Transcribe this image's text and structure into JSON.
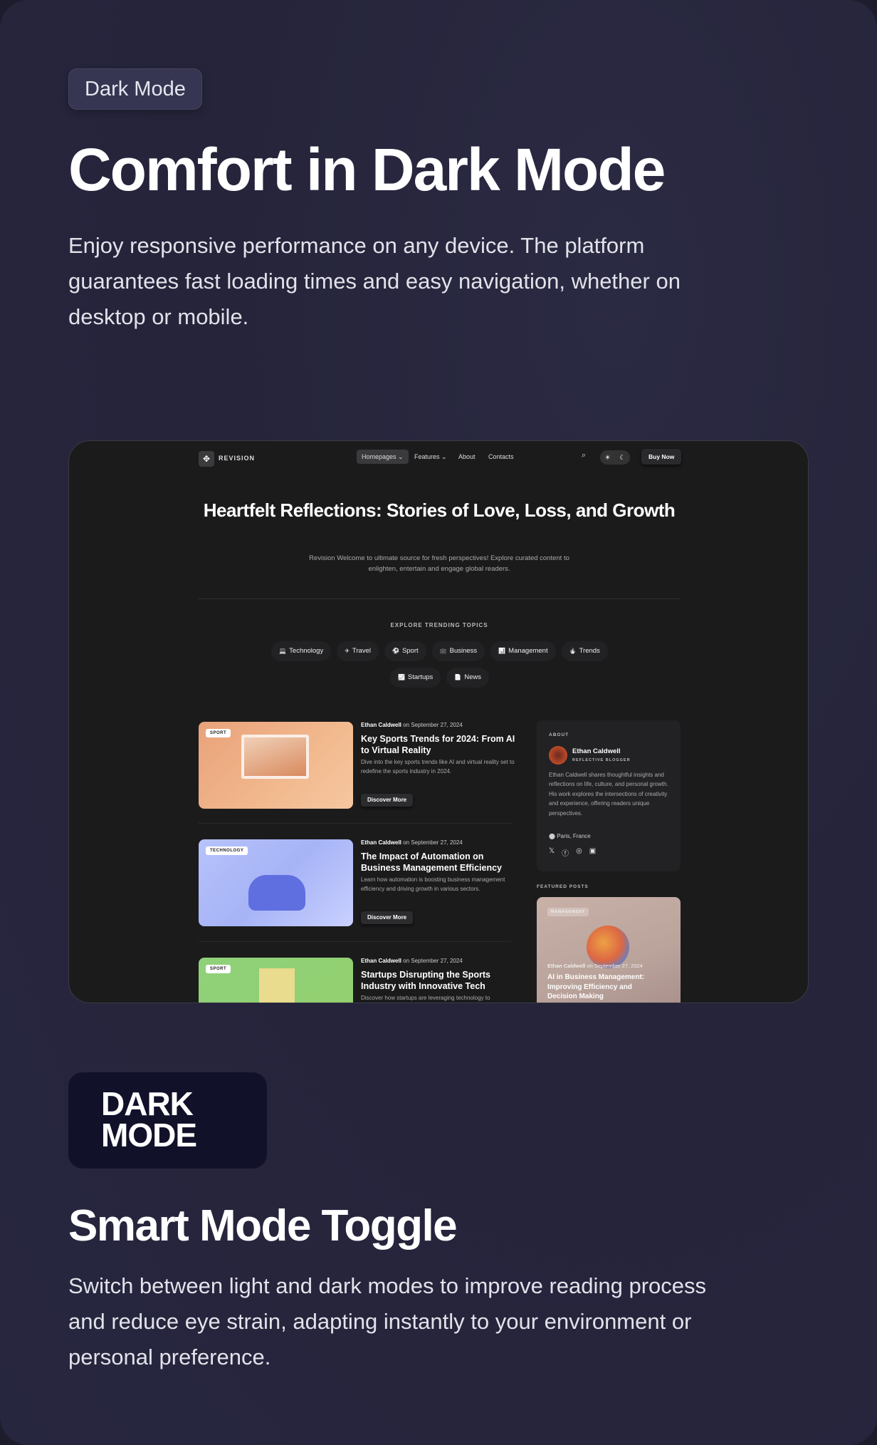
{
  "badge": "Dark Mode",
  "hero": {
    "title": "Comfort in Dark Mode",
    "description": "Enjoy responsive performance on any device. The platform guarantees fast loading times and easy navigation, whether on desktop or mobile."
  },
  "preview": {
    "brand": "REVISION",
    "nav": [
      {
        "label": "Homepages ⌄"
      },
      {
        "label": "Features ⌄"
      },
      {
        "label": "About"
      },
      {
        "label": "Contacts"
      }
    ],
    "buy_label": "Buy Now",
    "title": "Heartfelt Reflections: Stories of Love, Loss, and Growth",
    "subtitle": "Revision Welcome to ultimate source for fresh perspectives! Explore curated content to enlighten, entertain and engage global readers.",
    "explore_label": "EXPLORE TRENDING TOPICS",
    "topics": [
      {
        "icon": "laptop-icon",
        "glyph": "💻",
        "label": "Technology"
      },
      {
        "icon": "plane-icon",
        "glyph": "✈",
        "label": "Travel"
      },
      {
        "icon": "ball-icon",
        "glyph": "⚽",
        "label": "Sport"
      },
      {
        "icon": "briefcase-icon",
        "glyph": "💼",
        "label": "Business"
      },
      {
        "icon": "chart-icon",
        "glyph": "📊",
        "label": "Management"
      },
      {
        "icon": "fire-icon",
        "glyph": "🔥",
        "label": "Trends"
      },
      {
        "icon": "presentation-icon",
        "glyph": "📈",
        "label": "Startups"
      },
      {
        "icon": "document-icon",
        "glyph": "📄",
        "label": "News"
      }
    ],
    "posts": [
      {
        "tag": "SPORT",
        "author": "Ethan Caldwell",
        "date": "on September 27, 2024",
        "title": "Key Sports Trends for 2024: From AI to Virtual Reality",
        "desc": "Dive into the key sports trends like AI and virtual reality set to redefine the sports industry in 2024.",
        "button": "Discover More"
      },
      {
        "tag": "TECHNOLOGY",
        "author": "Ethan Caldwell",
        "date": "on September 27, 2024",
        "title": "The Impact of Automation on Business Management Efficiency",
        "desc": "Learn how automation is boosting business management efficiency and driving growth in various sectors.",
        "button": "Discover More"
      },
      {
        "tag": "SPORT",
        "author": "Ethan Caldwell",
        "date": "on September 27, 2024",
        "title": "Startups Disrupting the Sports Industry with Innovative Tech",
        "desc": "Discover how startups are leveraging technology to"
      }
    ],
    "about": {
      "label": "ABOUT",
      "name": "Ethan Caldwell",
      "role": "REFLECTIVE BLOGGER",
      "bio": "Ethan Caldwell shares thoughtful insights and reflections on life, culture, and personal growth. His work explores the intersections of creativity and experience, offering readers unique perspectives.",
      "location": "Paris, France"
    },
    "featured": {
      "label": "FEATURED POSTS",
      "tag": "MANAGEMENT",
      "author": "Ethan Caldwell",
      "date": "on September 27, 2024",
      "title": "AI in Business Management: Improving Efficiency and Decision Making"
    }
  },
  "logo": {
    "line1": "DARK",
    "line2": "MODE"
  },
  "toggle_section": {
    "title": "Smart Mode Toggle",
    "description": "Switch between light and dark modes to improve reading process and reduce eye strain, adapting instantly to your environment or personal preference."
  }
}
